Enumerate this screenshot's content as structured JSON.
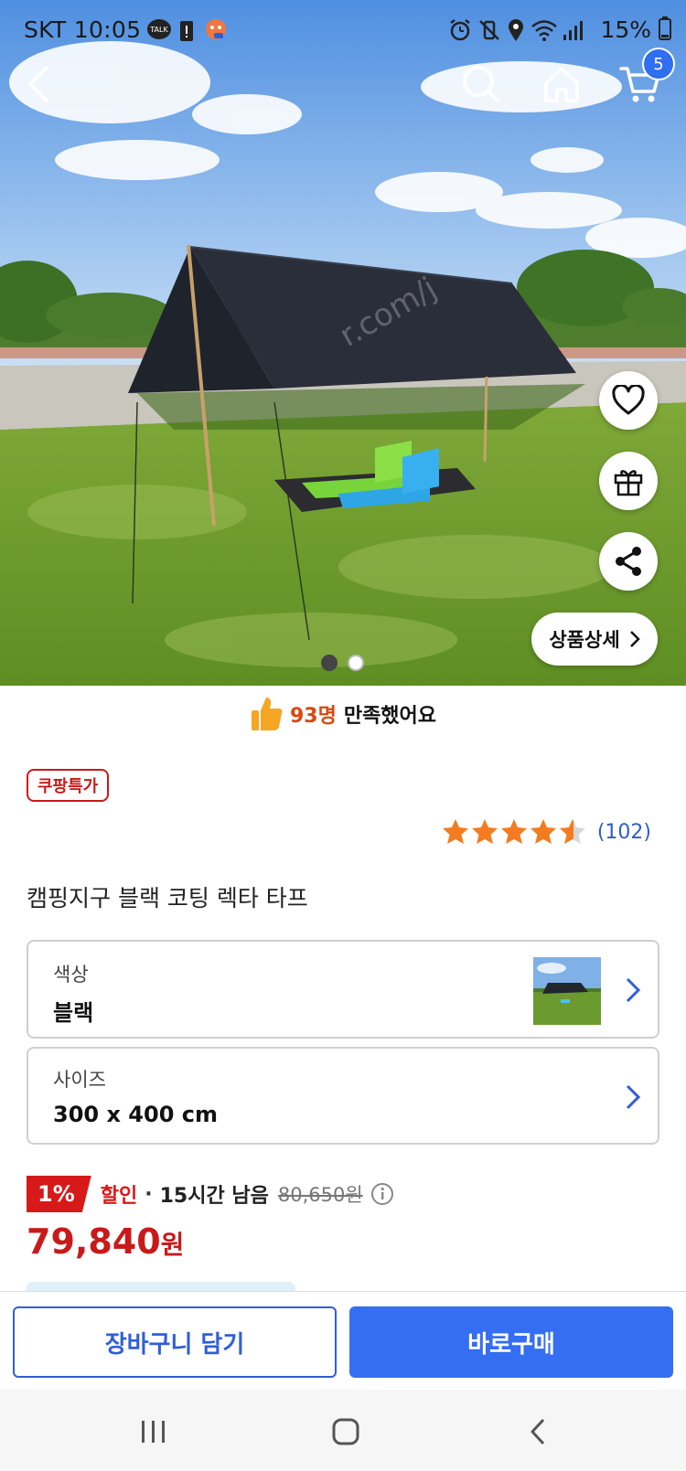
{
  "status_bar": {
    "carrier_time": "SKT 10:05",
    "battery": "15%"
  },
  "nav": {
    "cart_count": "5",
    "icons": [
      "back-arrow-icon",
      "search-icon",
      "home-icon",
      "cart-icon"
    ]
  },
  "hero": {
    "detail_button_label": "상품상세",
    "pager_total": 2,
    "pager_active": 1
  },
  "satisfaction": {
    "count": "93명",
    "text": "만족했어요"
  },
  "product": {
    "badge": "쿠팡특가",
    "rating_stars": 4.5,
    "rating_count": "(102)",
    "title": "캠핑지구 블랙 코팅 렉타 타프"
  },
  "options": [
    {
      "label": "색상",
      "value": "블랙"
    },
    {
      "label": "사이즈",
      "value": "300 x 400 cm"
    }
  ],
  "price": {
    "discount_rate": "1%",
    "discount_label": "할인",
    "separator": "·",
    "time_left": "15시간 남음",
    "original_price": "80,650원",
    "sale_price": "79,840",
    "sale_price_unit": "원"
  },
  "actions": {
    "cart_label": "장바구니 담기",
    "buy_label": "바로구매"
  },
  "colors": {
    "accent_blue": "#356ef0",
    "sale_red": "#c81a1a",
    "star_orange": "#f47b20"
  }
}
